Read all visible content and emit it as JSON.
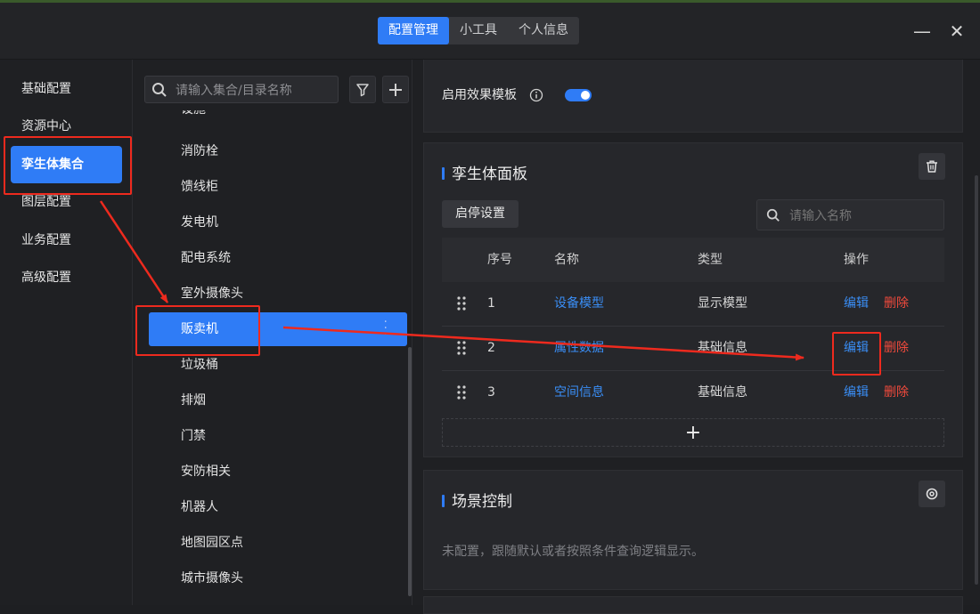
{
  "header": {
    "tabs": [
      {
        "label": "配置管理",
        "active": true
      },
      {
        "label": "小工具",
        "active": false
      },
      {
        "label": "个人信息",
        "active": false
      }
    ],
    "minimize_glyph": "—",
    "close_glyph": "✕"
  },
  "sidebar": {
    "items": [
      {
        "label": "基础配置"
      },
      {
        "label": "资源中心"
      },
      {
        "label": "孪生体集合",
        "active": true
      },
      {
        "label": "图层配置"
      },
      {
        "label": "业务配置"
      },
      {
        "label": "高级配置"
      }
    ]
  },
  "collection_list": {
    "search_placeholder": "请输入集合/目录名称",
    "partial_item": "设施",
    "items": [
      {
        "label": "消防栓"
      },
      {
        "label": "馈线柜"
      },
      {
        "label": "发电机"
      },
      {
        "label": "配电系统"
      },
      {
        "label": "室外摄像头"
      },
      {
        "label": "贩卖机",
        "active": true
      },
      {
        "label": "垃圾桶"
      },
      {
        "label": "排烟"
      },
      {
        "label": "门禁"
      },
      {
        "label": "安防相关"
      },
      {
        "label": "机器人"
      },
      {
        "label": "地图园区点"
      },
      {
        "label": "城市摄像头"
      }
    ]
  },
  "effect_template": {
    "label": "启用效果模板",
    "enabled": true
  },
  "twin_panel": {
    "title": "孪生体面板",
    "toggle_button": "启停设置",
    "search_placeholder": "请输入名称",
    "columns": [
      "序号",
      "名称",
      "类型",
      "操作"
    ],
    "rows": [
      {
        "index": "1",
        "name": "设备模型",
        "type": "显示模型",
        "edit": "编辑",
        "delete": "删除"
      },
      {
        "index": "2",
        "name": "属性数据",
        "type": "基础信息",
        "edit": "编辑",
        "delete": "删除"
      },
      {
        "index": "3",
        "name": "空间信息",
        "type": "基础信息",
        "edit": "编辑",
        "delete": "删除"
      }
    ],
    "add_glyph": "+"
  },
  "scene_panel": {
    "title": "场景控制",
    "empty_text": "未配置，跟随默认或者按照条件查询逻辑显示。"
  },
  "colors": {
    "accent": "#2f7cf6",
    "danger": "#f04a3c",
    "annotation": "#ee2a1e",
    "background": "#1f2023"
  }
}
